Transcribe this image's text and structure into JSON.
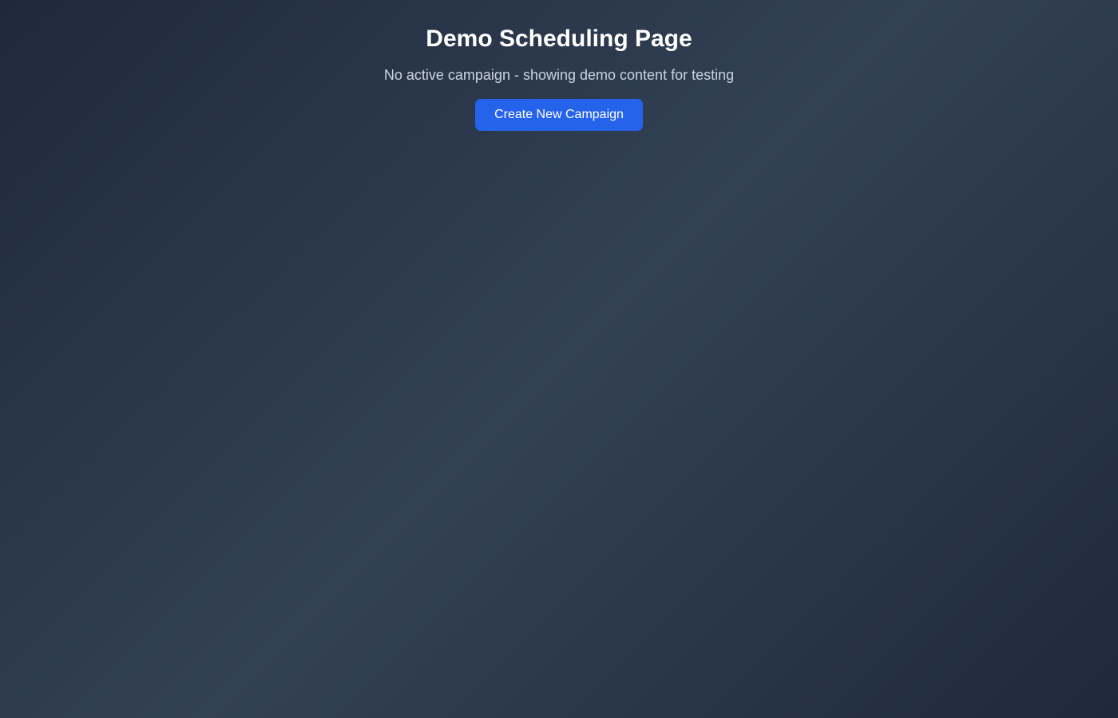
{
  "page": {
    "title": "Demo Scheduling Page",
    "subtitle": "No active campaign - showing demo content for testing",
    "create_button_label": "Create New Campaign"
  },
  "colors": {
    "background_dark": "#1e293b",
    "background_light": "#334155",
    "accent": "#2563eb",
    "subtitle_text": "#cbd5e1"
  }
}
